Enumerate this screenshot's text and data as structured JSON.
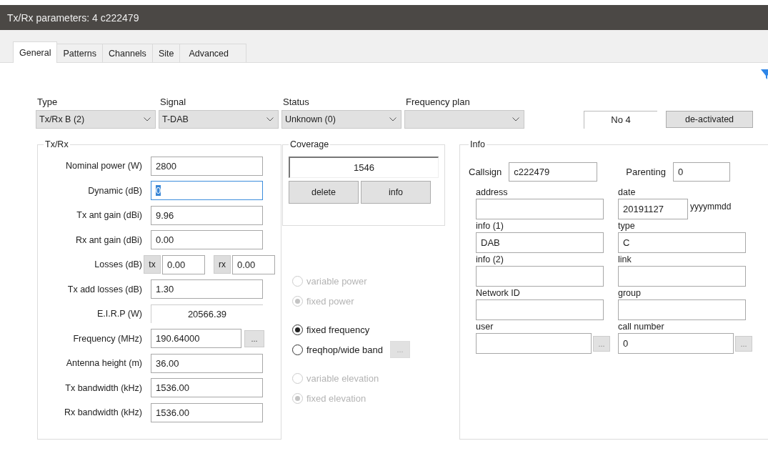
{
  "window": {
    "title": "Tx/Rx parameters: 4 c222479"
  },
  "tabs": [
    {
      "label": "General",
      "selected": true
    },
    {
      "label": "Patterns",
      "selected": false
    },
    {
      "label": "Channels",
      "selected": false
    },
    {
      "label": "Site",
      "selected": false
    },
    {
      "label": "Advanced",
      "selected": false
    }
  ],
  "selectors": [
    {
      "label": "Type",
      "value": "Tx/Rx B (2)"
    },
    {
      "label": "Signal",
      "value": "T-DAB"
    },
    {
      "label": "Status",
      "value": "Unknown (0)"
    },
    {
      "label": "Frequency plan"
    }
  ],
  "number_field": {
    "value": "No 4"
  },
  "activation_button": "de-activated",
  "txrx": {
    "title": "Tx/Rx",
    "rows": [
      {
        "kind": "field",
        "label": "Nominal power (W)",
        "value": "2800",
        "focused": false
      },
      {
        "kind": "field",
        "label": "Dynamic (dB)",
        "value": "0",
        "focused": true
      },
      {
        "kind": "field",
        "label": "Tx ant gain (dBi)",
        "value": "9.96",
        "focused": false
      },
      {
        "kind": "field",
        "label": "Rx ant gain (dBi)",
        "value": "0.00",
        "focused": false
      },
      {
        "kind": "losses",
        "label": "Losses (dB)",
        "tx_label": "tx",
        "tx_value": "0.00",
        "rx_label": "rx",
        "rx_value": "0.00"
      },
      {
        "kind": "field",
        "label": "Tx add losses (dB)",
        "value": "1.30",
        "focused": false
      },
      {
        "kind": "readout",
        "label": "E.I.R.P (W)",
        "value": "20566.39"
      },
      {
        "kind": "field_more",
        "label": "Frequency (MHz)",
        "value": "190.64000",
        "button": "..."
      },
      {
        "kind": "field",
        "label": "Antenna height (m)",
        "value": "36.00",
        "focused": false
      },
      {
        "kind": "field",
        "label": "Tx bandwidth (kHz)",
        "value": "1536.00",
        "focused": false
      },
      {
        "kind": "field",
        "label": "Rx bandwidth (kHz)",
        "value": "1536.00",
        "focused": false
      }
    ]
  },
  "coverage": {
    "title": "Coverage",
    "value": "1546",
    "buttons": [
      "delete",
      "info"
    ]
  },
  "option_groups": [
    {
      "options": [
        {
          "label": "variable power",
          "selected": false,
          "disabled": true
        },
        {
          "label": "fixed power",
          "selected": true,
          "disabled": true
        }
      ]
    },
    {
      "options": [
        {
          "label": "fixed frequency",
          "selected": true,
          "disabled": false
        },
        {
          "label": "freqhop/wide band",
          "selected": false,
          "disabled": false,
          "button": "...",
          "button_disabled": true
        }
      ]
    },
    {
      "options": [
        {
          "label": "variable elevation",
          "selected": false,
          "disabled": true
        },
        {
          "label": "fixed elevation",
          "selected": true,
          "disabled": true
        }
      ]
    }
  ],
  "info": {
    "title": "Info",
    "callsign": {
      "label": "Callsign",
      "value": "c222479"
    },
    "parenting": {
      "label": "Parenting",
      "value": "0"
    },
    "fields": [
      {
        "label": "address"
      },
      {
        "label": "date",
        "value": "20191127",
        "suffix": "yyyymmdd"
      },
      {
        "label": "info (1)",
        "value": "DAB"
      },
      {
        "label": "type",
        "value": "C"
      },
      {
        "label": "info (2)"
      },
      {
        "label": "link"
      },
      {
        "label": "Network ID"
      },
      {
        "label": "group"
      },
      {
        "label": "user",
        "button": "..."
      },
      {
        "label": "call number",
        "value": "0",
        "button": "..."
      }
    ]
  }
}
